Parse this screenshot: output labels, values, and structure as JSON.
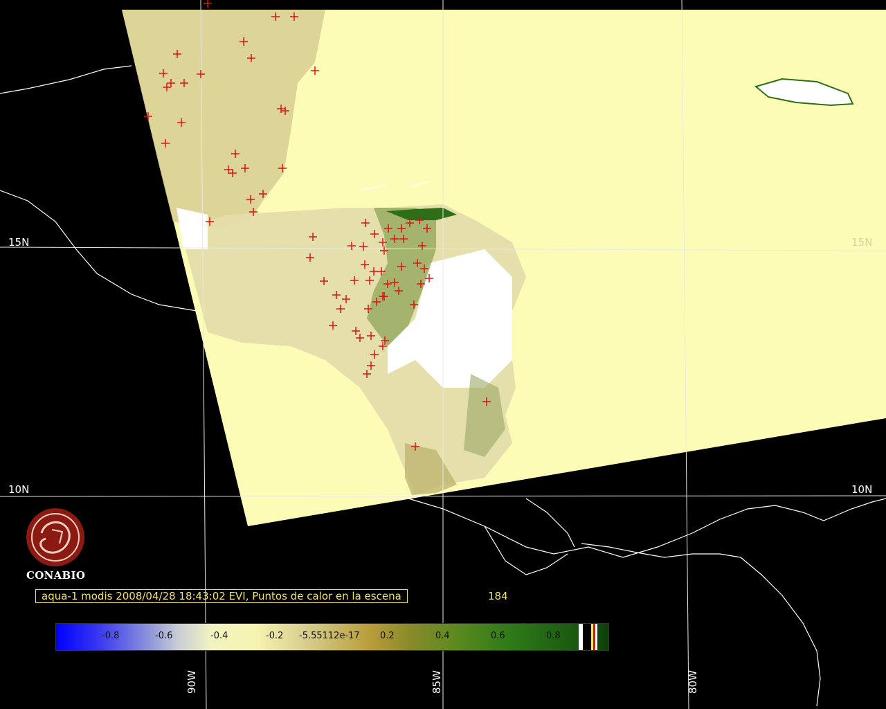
{
  "caption": {
    "text": "aqua-1 modis 2008/04/28 18:43:02 EVI, Puntos de calor en la escena",
    "count": "184"
  },
  "logo": {
    "name": "CONABIO"
  },
  "graticule": {
    "lat_labels": [
      "15N",
      "10N"
    ],
    "lon_labels": [
      "90W",
      "85W",
      "80W"
    ]
  },
  "colorbar": {
    "ticks": [
      "-0.8",
      "-0.6",
      "-0.4",
      "-0.2",
      "-5.55112e-17",
      "0.2",
      "0.4",
      "0.6",
      "0.8"
    ]
  },
  "colors": {
    "background": "#000000",
    "scene_fill": "#fdfcb6",
    "fire_marker": "#e01010",
    "caption": "#f2e06a",
    "logo": "#8b1a12"
  }
}
